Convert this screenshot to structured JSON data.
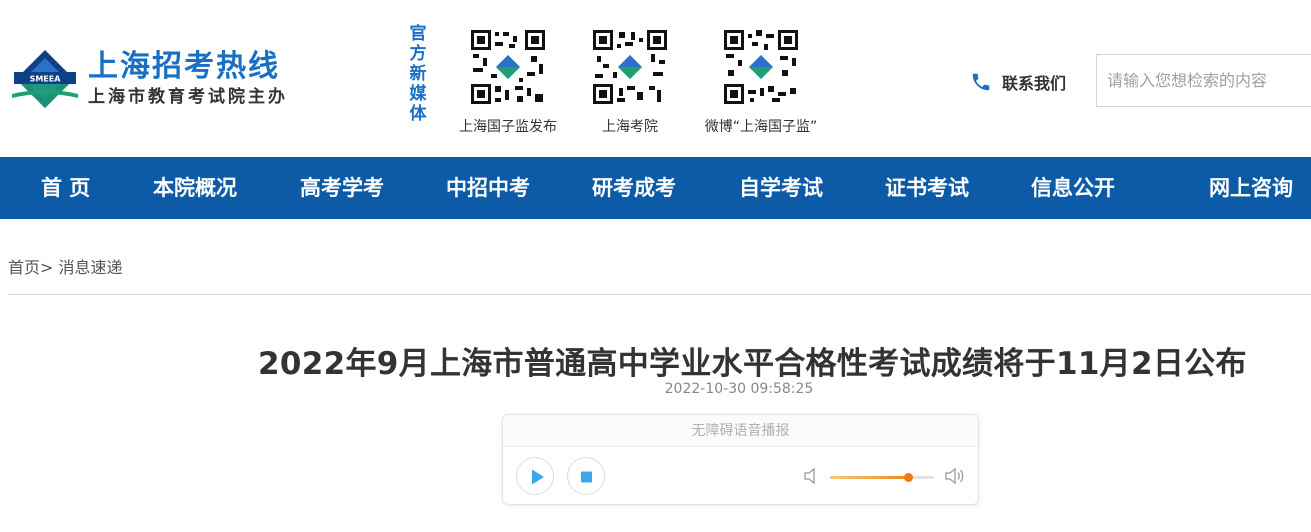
{
  "site": {
    "title": "上海招考热线",
    "subtitle": "上海市教育考试院主办",
    "logo_text": "SMEEA"
  },
  "media": {
    "label": "官方新媒体",
    "qrcodes": [
      {
        "caption": "上海国子监发布"
      },
      {
        "caption": "上海考院"
      },
      {
        "caption": "微博“上海国子监”"
      }
    ]
  },
  "contact": {
    "label": "联系我们",
    "icon": "phone-icon"
  },
  "search": {
    "placeholder": "请输入您想检索的内容"
  },
  "nav": {
    "items": [
      {
        "label": "首 页"
      },
      {
        "label": "本院概况"
      },
      {
        "label": "高考学考"
      },
      {
        "label": "中招中考"
      },
      {
        "label": "研考成考"
      },
      {
        "label": "自学考试"
      },
      {
        "label": "证书考试"
      },
      {
        "label": "信息公开"
      },
      {
        "label": "网上咨询"
      }
    ]
  },
  "breadcrumb": {
    "home": "首页>",
    "current": "消息速递"
  },
  "article": {
    "title": "2022年9月上海市普通高中学业水平合格性考试成绩将于11月2日公布",
    "date": "2022-10-30 09:58:25"
  },
  "player": {
    "header": "无障碍语音播报",
    "volume": 0.75
  },
  "colors": {
    "brand_blue": "#1a6fc4",
    "nav_bg": "#0d5ba6",
    "player_accent": "#3aa8e8",
    "volume_orange": "#ee7a10"
  }
}
